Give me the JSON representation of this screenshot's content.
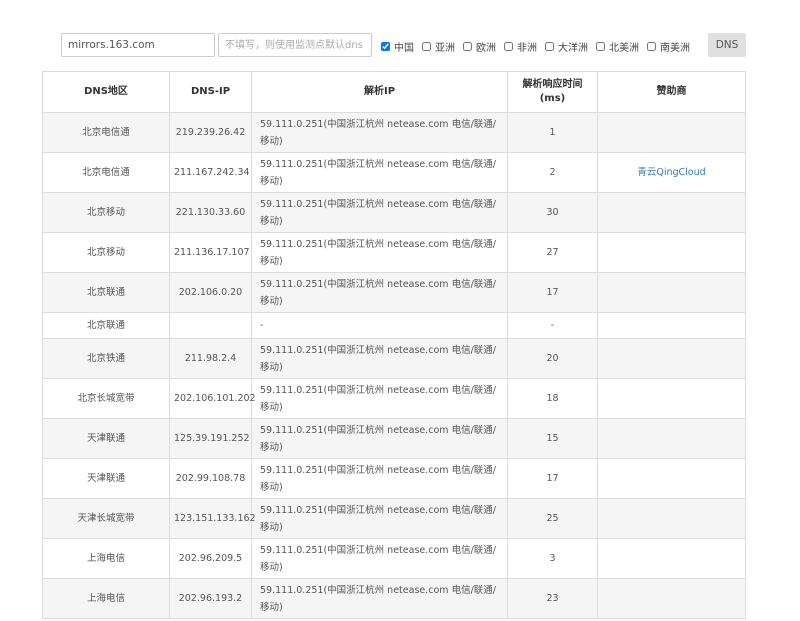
{
  "toolbar": {
    "domain_value": "mirrors.163.com",
    "dns_placeholder": "不填写，则使用监测点默认dns",
    "regions": [
      {
        "label": "中国",
        "checked": true
      },
      {
        "label": "亚洲",
        "checked": false
      },
      {
        "label": "欧洲",
        "checked": false
      },
      {
        "label": "非洲",
        "checked": false
      },
      {
        "label": "大洋洲",
        "checked": false
      },
      {
        "label": "北美洲",
        "checked": false
      },
      {
        "label": "南美洲",
        "checked": false
      }
    ],
    "dns_button_label": "DNS"
  },
  "table": {
    "headers": {
      "region": "DNS地区",
      "dns_ip": "DNS-IP",
      "resolved_ip": "解析IP",
      "response_time": "解析响应时间",
      "response_unit": "(ms)",
      "sponsor": "赞助商"
    },
    "rows": [
      {
        "region": "北京电信通",
        "dns_ip": "219.239.26.42",
        "resolved": "59.111.0.251(中国浙江杭州 netease.com 电信/联通/移动)",
        "time": "1",
        "sponsor": ""
      },
      {
        "region": "北京电信通",
        "dns_ip": "211.167.242.34",
        "resolved": "59.111.0.251(中国浙江杭州 netease.com 电信/联通/移动)",
        "time": "2",
        "sponsor": "青云QingCloud"
      },
      {
        "region": "北京移动",
        "dns_ip": "221.130.33.60",
        "resolved": "59.111.0.251(中国浙江杭州 netease.com 电信/联通/移动)",
        "time": "30",
        "sponsor": ""
      },
      {
        "region": "北京移动",
        "dns_ip": "211.136.17.107",
        "resolved": "59.111.0.251(中国浙江杭州 netease.com 电信/联通/移动)",
        "time": "27",
        "sponsor": ""
      },
      {
        "region": "北京联通",
        "dns_ip": "202.106.0.20",
        "resolved": "59.111.0.251(中国浙江杭州 netease.com 电信/联通/移动)",
        "time": "17",
        "sponsor": ""
      },
      {
        "region": "北京联通",
        "dns_ip": "",
        "resolved": "-",
        "time": "-",
        "sponsor": ""
      },
      {
        "region": "北京铁通",
        "dns_ip": "211.98.2.4",
        "resolved": "59.111.0.251(中国浙江杭州 netease.com 电信/联通/移动)",
        "time": "20",
        "sponsor": ""
      },
      {
        "region": "北京长城宽带",
        "dns_ip": "202.106.101.202",
        "resolved": "59.111.0.251(中国浙江杭州 netease.com 电信/联通/移动)",
        "time": "18",
        "sponsor": ""
      },
      {
        "region": "天津联通",
        "dns_ip": "125.39.191.252",
        "resolved": "59.111.0.251(中国浙江杭州 netease.com 电信/联通/移动)",
        "time": "15",
        "sponsor": ""
      },
      {
        "region": "天津联通",
        "dns_ip": "202.99.108.78",
        "resolved": "59.111.0.251(中国浙江杭州 netease.com 电信/联通/移动)",
        "time": "17",
        "sponsor": ""
      },
      {
        "region": "天津长城宽带",
        "dns_ip": "123.151.133.162",
        "resolved": "59.111.0.251(中国浙江杭州 netease.com 电信/联通/移动)",
        "time": "25",
        "sponsor": ""
      },
      {
        "region": "上海电信",
        "dns_ip": "202.96.209.5",
        "resolved": "59.111.0.251(中国浙江杭州 netease.com 电信/联通/移动)",
        "time": "3",
        "sponsor": ""
      },
      {
        "region": "上海电信",
        "dns_ip": "202.96.193.2",
        "resolved": "59.111.0.251(中国浙江杭州 netease.com 电信/联通/移动)",
        "time": "23",
        "sponsor": ""
      }
    ]
  }
}
